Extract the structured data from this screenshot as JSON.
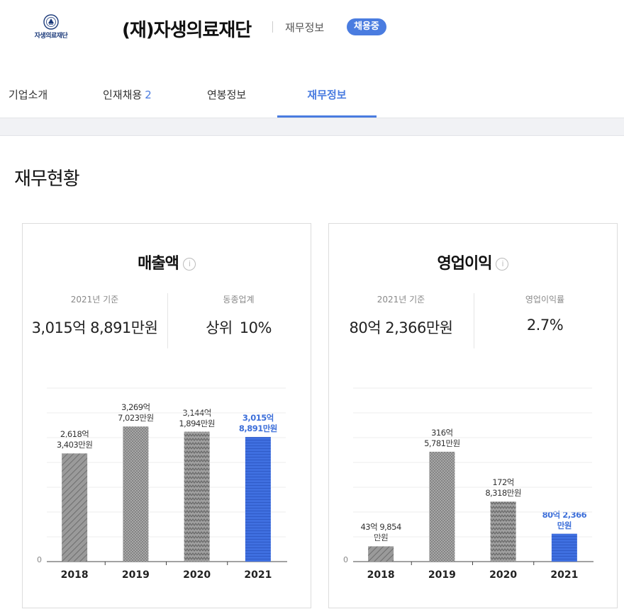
{
  "header": {
    "logo_text": "자생의료재단",
    "company_name": "(재)자생의료재단",
    "subtitle": "재무정보",
    "badge": "채용중"
  },
  "tabs": [
    {
      "label": "기업소개",
      "count": ""
    },
    {
      "label": "인재채용",
      "count": "2"
    },
    {
      "label": "연봉정보",
      "count": ""
    },
    {
      "label": "재무정보",
      "count": "",
      "active": true
    }
  ],
  "section_title": "재무현황",
  "cards": [
    {
      "title": "매출액",
      "stat_left_label": "2021년 기준",
      "stat_left_value": "3,015억 8,891만원",
      "stat_right_label": "동종업계",
      "stat_right_prefix": "상위",
      "stat_right_value": "10%"
    },
    {
      "title": "영업이익",
      "stat_left_label": "2021년 기준",
      "stat_left_value": "80억 2,366만원",
      "stat_right_label": "영업이익률",
      "stat_right_prefix": "",
      "stat_right_value": "2.7%"
    }
  ],
  "chart_data": [
    {
      "type": "bar",
      "title": "매출액",
      "categories": [
        "2018",
        "2019",
        "2020",
        "2021"
      ],
      "values": [
        261834.03,
        326970.23,
        314418.94,
        301588.91
      ],
      "unit": "만원",
      "value_labels": [
        [
          "2,618억",
          "3,403만원"
        ],
        [
          "3,269억",
          "7,023만원"
        ],
        [
          "3,144억",
          "1,894만원"
        ],
        [
          "3,015억",
          "8,891만원"
        ]
      ],
      "ylim": [
        0,
        420000
      ],
      "y_tick_label": "0",
      "highlight_index": 3,
      "colors": {
        "bar": "#9a9a9a",
        "highlight": "#3f6fe0"
      }
    },
    {
      "type": "bar",
      "title": "영업이익",
      "categories": [
        "2018",
        "2019",
        "2020",
        "2021"
      ],
      "values": [
        439854,
        3165781,
        1728318,
        802366
      ],
      "unit": "만원",
      "value_labels": [
        [
          "43억 9,854",
          "만원"
        ],
        [
          "316억",
          "5,781만원"
        ],
        [
          "172억",
          "8,318만원"
        ],
        [
          "80억 2,366",
          "만원"
        ]
      ],
      "ylim": [
        0,
        5000000
      ],
      "y_tick_label": "0",
      "highlight_index": 3,
      "colors": {
        "bar": "#9a9a9a",
        "highlight": "#3f6fe0"
      }
    }
  ]
}
